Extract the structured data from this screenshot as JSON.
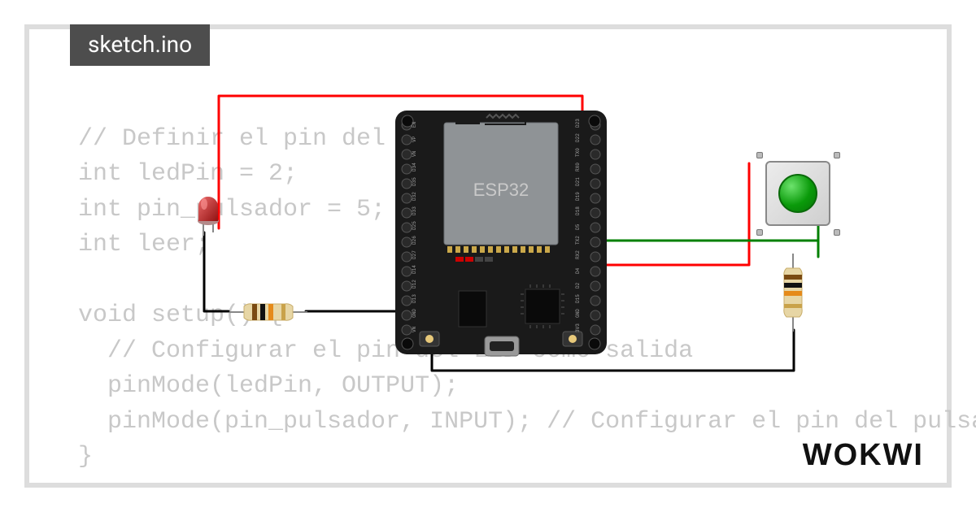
{
  "tab": {
    "filename": "sketch.ino"
  },
  "code": {
    "line1": "// Definir el pin del LED",
    "line2": "int ledPin = 2;",
    "line3": "int pin_pulsador = 5;",
    "line4": "int leer;",
    "line5": "",
    "line6": "void setup() {",
    "line7": "  // Configurar el pin del LED como salida",
    "line8": "  pinMode(ledPin, OUTPUT);",
    "line9": "  pinMode(pin_pulsador, INPUT); // Configurar el pin del pulsador como",
    "line10": "}"
  },
  "brand": "WOKWI",
  "board": {
    "label": "ESP32",
    "left_pin_labels": [
      "VN",
      "GND",
      "D13",
      "D12",
      "D14",
      "D27",
      "D26",
      "D25",
      "D33",
      "D32",
      "D35",
      "D34",
      "VN",
      "VP",
      "EN"
    ],
    "right_pin_labels": [
      "3V3",
      "GND",
      "D15",
      "D2",
      "D4",
      "RX2",
      "TX2",
      "D5",
      "D18",
      "D19",
      "D21",
      "RX0",
      "TX0",
      "D22",
      "D23"
    ]
  },
  "components": {
    "led": {
      "color": "#e01a1a",
      "name": "led-red"
    },
    "resistor1_name": "resistor-led",
    "resistor2_name": "resistor-button",
    "button_name": "pushbutton-green"
  },
  "wires": {
    "colors": {
      "power": "#ff0000",
      "signal": "#008000",
      "ground": "#000000"
    }
  }
}
